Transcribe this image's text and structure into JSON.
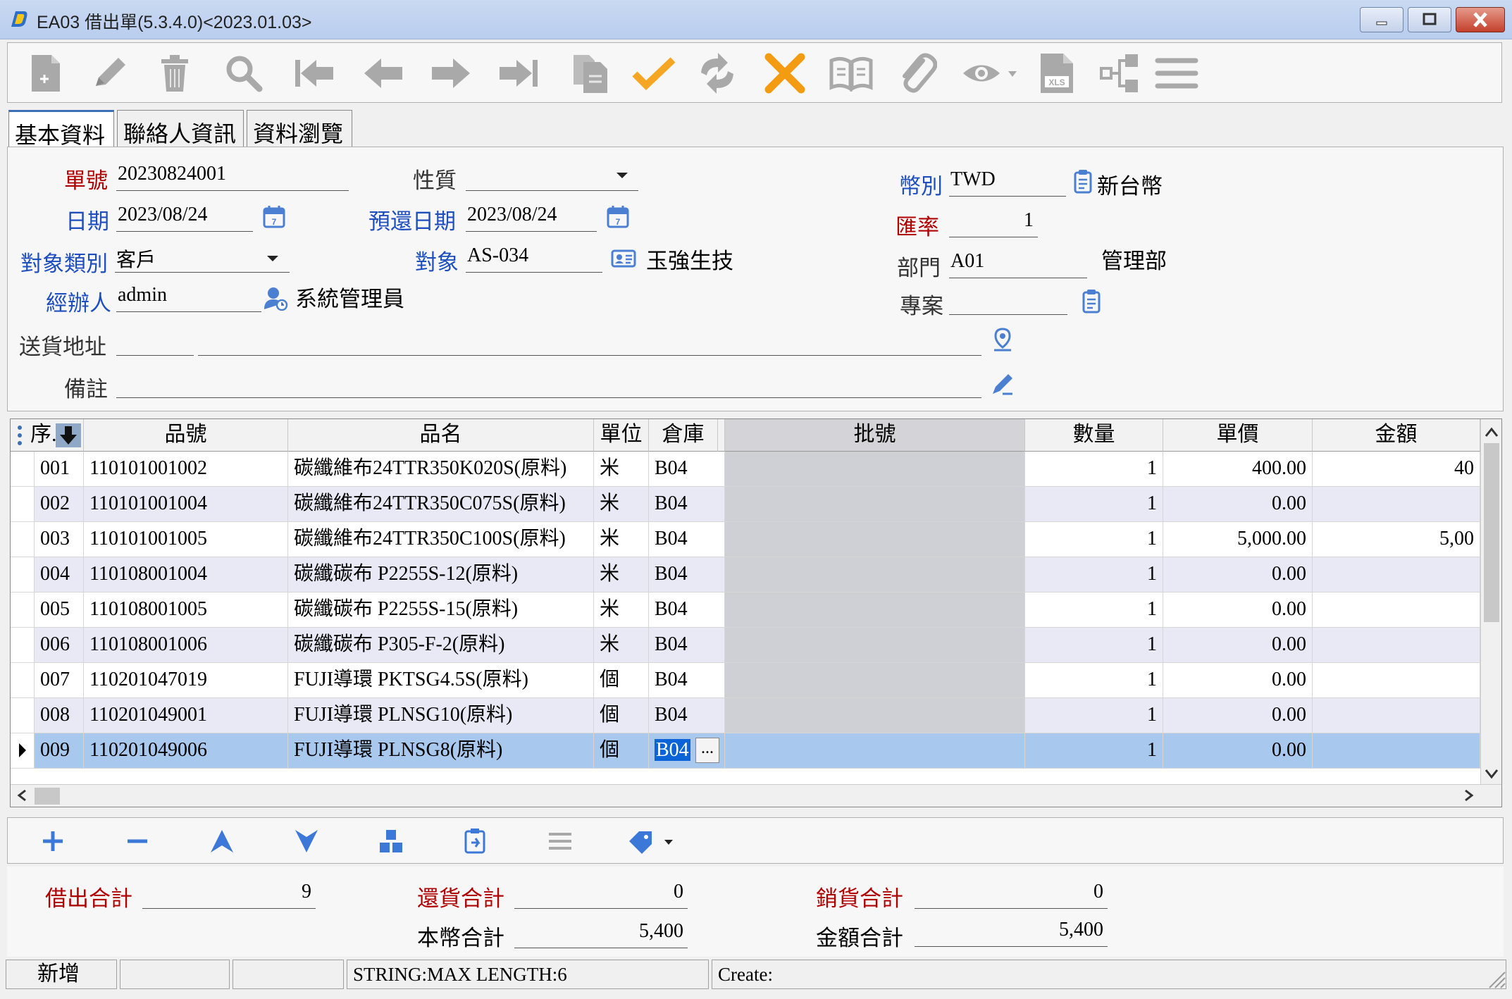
{
  "window": {
    "title": "EA03 借出單(5.3.4.0)<2023.01.03>"
  },
  "toolbar": {
    "buttons": [
      {
        "name": "new-icon"
      },
      {
        "name": "edit-icon"
      },
      {
        "name": "delete-icon"
      },
      {
        "name": "search-icon"
      },
      {
        "name": "first-record-icon"
      },
      {
        "name": "previous-record-icon"
      },
      {
        "name": "next-record-icon"
      },
      {
        "name": "last-record-icon"
      },
      {
        "name": "copy-icon"
      },
      {
        "name": "confirm-icon"
      },
      {
        "name": "refresh-icon"
      },
      {
        "name": "cancel-icon"
      },
      {
        "name": "book-icon"
      },
      {
        "name": "attachment-icon"
      },
      {
        "name": "preview-icon"
      },
      {
        "name": "excel-icon"
      },
      {
        "name": "flow-icon"
      },
      {
        "name": "menu-icon"
      }
    ],
    "colors": {
      "gray": "#a8a8a8",
      "confirm": "#f5a623",
      "cancel": "#f39c12"
    }
  },
  "tabs": [
    "基本資料",
    "聯絡人資訊",
    "資料瀏覽"
  ],
  "form": {
    "doc_no": {
      "label": "單號",
      "value": "20230824001"
    },
    "nature": {
      "label": "性質",
      "value": ""
    },
    "currency": {
      "label": "幣別",
      "value": "TWD",
      "name": "新台幣"
    },
    "date": {
      "label": "日期",
      "value": "2023/08/24"
    },
    "return_date": {
      "label": "預還日期",
      "value": "2023/08/24"
    },
    "rate": {
      "label": "匯率",
      "value": "1"
    },
    "target_type": {
      "label": "對象類別",
      "value": "客戶"
    },
    "target": {
      "label": "對象",
      "value": "AS-034",
      "name": "玉強生技"
    },
    "dept": {
      "label": "部門",
      "value": "A01",
      "name": "管理部"
    },
    "handler": {
      "label": "經辦人",
      "value": "admin",
      "name": "系統管理員"
    },
    "project": {
      "label": "專案",
      "value": ""
    },
    "address": {
      "label": "送貨地址",
      "value1": "",
      "value2": ""
    },
    "remark": {
      "label": "備註",
      "value": ""
    }
  },
  "grid": {
    "headers": {
      "seq": "序.",
      "part_no": "品號",
      "part_name": "品名",
      "unit": "單位",
      "warehouse": "倉庫",
      "batch": "批號",
      "qty": "數量",
      "price": "單價",
      "amount": "金額"
    },
    "rows": [
      {
        "seq": "001",
        "part_no": "110101001002",
        "part_name": "碳纖維布24TTR350K020S(原料)",
        "unit": "米",
        "warehouse": "B04",
        "batch": "",
        "qty": "1",
        "price": "400.00",
        "amount": "40"
      },
      {
        "seq": "002",
        "part_no": "110101001004",
        "part_name": "碳纖維布24TTR350C075S(原料)",
        "unit": "米",
        "warehouse": "B04",
        "batch": "",
        "qty": "1",
        "price": "0.00",
        "amount": ""
      },
      {
        "seq": "003",
        "part_no": "110101001005",
        "part_name": "碳纖維布24TTR350C100S(原料)",
        "unit": "米",
        "warehouse": "B04",
        "batch": "",
        "qty": "1",
        "price": "5,000.00",
        "amount": "5,00"
      },
      {
        "seq": "004",
        "part_no": "110108001004",
        "part_name": "碳纖碳布 P2255S-12(原料)",
        "unit": "米",
        "warehouse": "B04",
        "batch": "",
        "qty": "1",
        "price": "0.00",
        "amount": ""
      },
      {
        "seq": "005",
        "part_no": "110108001005",
        "part_name": "碳纖碳布 P2255S-15(原料)",
        "unit": "米",
        "warehouse": "B04",
        "batch": "",
        "qty": "1",
        "price": "0.00",
        "amount": ""
      },
      {
        "seq": "006",
        "part_no": "110108001006",
        "part_name": "碳纖碳布 P305-F-2(原料)",
        "unit": "米",
        "warehouse": "B04",
        "batch": "",
        "qty": "1",
        "price": "0.00",
        "amount": ""
      },
      {
        "seq": "007",
        "part_no": "110201047019",
        "part_name": "FUJI導環 PKTSG4.5S(原料)",
        "unit": "個",
        "warehouse": "B04",
        "batch": "",
        "qty": "1",
        "price": "0.00",
        "amount": ""
      },
      {
        "seq": "008",
        "part_no": "110201049001",
        "part_name": "FUJI導環 PLNSG10(原料)",
        "unit": "個",
        "warehouse": "B04",
        "batch": "",
        "qty": "1",
        "price": "0.00",
        "amount": ""
      },
      {
        "seq": "009",
        "part_no": "110201049006",
        "part_name": "FUJI導環 PLNSG8(原料)",
        "unit": "個",
        "warehouse": "B04",
        "batch": "",
        "qty": "1",
        "price": "0.00",
        "amount": ""
      }
    ],
    "selected_index": 8,
    "ellipsis": "..."
  },
  "grid_toolbar": {
    "buttons": [
      {
        "name": "add-row-icon"
      },
      {
        "name": "remove-row-icon"
      },
      {
        "name": "move-up-icon"
      },
      {
        "name": "move-down-icon"
      },
      {
        "name": "batch-icon"
      },
      {
        "name": "paste-icon"
      },
      {
        "name": "list-icon"
      },
      {
        "name": "tag-icon"
      }
    ]
  },
  "totals": {
    "borrow_total": {
      "label": "借出合計",
      "value": "9"
    },
    "return_total": {
      "label": "還貨合計",
      "value": "0"
    },
    "sales_total": {
      "label": "銷貨合計",
      "value": "0"
    },
    "local_total": {
      "label": "本幣合計",
      "value": "5,400"
    },
    "amount_total": {
      "label": "金額合計",
      "value": "5,400"
    }
  },
  "status": {
    "mode": "新增",
    "field2": "",
    "field3": "",
    "message": "STRING:MAX LENGTH:6",
    "create": "Create:"
  }
}
